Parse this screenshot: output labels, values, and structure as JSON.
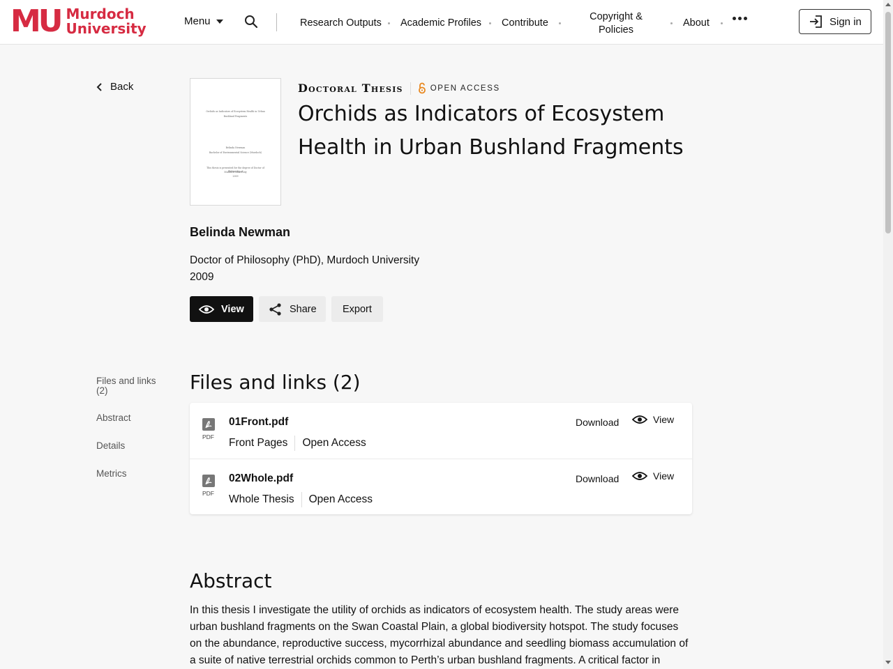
{
  "header": {
    "logo_mark": "MU",
    "logo_line1": "Murdoch",
    "logo_line2": "University",
    "menu_label": "Menu",
    "nav": [
      "Research Outputs",
      "Academic Profiles",
      "Contribute",
      "Copyright &",
      "Policies",
      "About"
    ],
    "signin_label": "Sign in"
  },
  "sidebar": {
    "back_label": "Back",
    "items": [
      "Files and links",
      "(2)",
      "Abstract",
      "Details",
      "Metrics"
    ]
  },
  "thumbnail": {
    "line1": "Orchids as Indicators of Ecosystem Health in Urban",
    "line2": "Bushland Fragments",
    "line3": "Belinda Newman",
    "line4": "Bachelor of Environmental Science (Murdoch)",
    "line5": "This thesis is presented for the degree of Doctor of Philosophy of",
    "line6": "Murdoch University",
    "line7": "2009"
  },
  "record": {
    "type": "Doctoral Thesis",
    "access": "OPEN ACCESS",
    "title_line1": "Orchids as Indicators of Ecosystem",
    "title_line2": "Health in Urban Bushland Fragments",
    "author": "Belinda Newman",
    "degree": "Doctor of Philosophy (PhD), Murdoch University",
    "year": "2009"
  },
  "actions": {
    "view": "View",
    "share": "Share",
    "export": "Export"
  },
  "files_section": {
    "heading": "Files and links (2)",
    "pdf_caption": "PDF",
    "download_label": "Download",
    "view_label": "View",
    "files": [
      {
        "name": "01Front.pdf",
        "description": "Front Pages",
        "access": "Open Access"
      },
      {
        "name": "02Whole.pdf",
        "description": "Whole Thesis",
        "access": "Open Access"
      }
    ]
  },
  "abstract_section": {
    "heading": "Abstract",
    "text": "In this thesis I investigate the utility of orchids as indicators of ecosystem health. The study areas were urban bushland fragments on the Swan Coastal Plain, a global biodiversity hotspot. The study focuses on the abundance, reproductive success, mycorrhizal abundance and seedling biomass accumulation of a suite of native terrestrial orchids common to Perth’s urban bushland fragments. A critical factor in"
  },
  "colors": {
    "brand": "#d62b42",
    "open_access": "#e8871e",
    "primary_button": "#111111"
  }
}
